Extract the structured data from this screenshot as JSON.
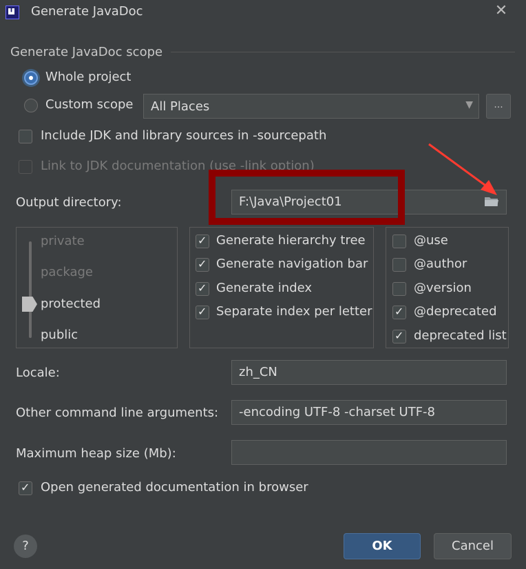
{
  "window": {
    "title": "Generate JavaDoc",
    "close_glyph": "✕"
  },
  "scope": {
    "section_label": "Generate JavaDoc scope",
    "whole_project": "Whole project",
    "custom_scope": "Custom scope",
    "custom_scope_value": "All Places",
    "more_button": "..."
  },
  "options": {
    "include_jdk": "Include JDK and library sources in -sourcepath",
    "link_jdk": "Link to JDK documentation (use -link option)"
  },
  "output": {
    "label": "Output directory:",
    "value": "F:\\Java\\Project01"
  },
  "visibility": {
    "levels": [
      "private",
      "package",
      "protected",
      "public"
    ],
    "selected": "protected"
  },
  "generate": {
    "items": [
      {
        "label": "Generate hierarchy tree",
        "checked": true
      },
      {
        "label": "Generate navigation bar",
        "checked": true
      },
      {
        "label": "Generate index",
        "checked": true
      },
      {
        "label": "Separate index per letter",
        "checked": true
      }
    ]
  },
  "tags": {
    "items": [
      {
        "label": "@use",
        "checked": false
      },
      {
        "label": "@author",
        "checked": false
      },
      {
        "label": "@version",
        "checked": false
      },
      {
        "label": "@deprecated",
        "checked": true
      },
      {
        "label": "deprecated list",
        "checked": true
      }
    ]
  },
  "locale": {
    "label": "Locale:",
    "value": "zh_CN"
  },
  "other_args": {
    "label": "Other command line arguments:",
    "value": "-encoding UTF-8 -charset UTF-8"
  },
  "heap": {
    "label": "Maximum heap size (Mb):",
    "value": ""
  },
  "open_browser": {
    "label": "Open generated documentation in browser",
    "checked": true
  },
  "buttons": {
    "help": "?",
    "ok": "OK",
    "cancel": "Cancel"
  },
  "colors": {
    "background": "#3c3f41",
    "accent": "#365880",
    "annotation": "#8b0000",
    "arrow": "#ff3b30"
  }
}
